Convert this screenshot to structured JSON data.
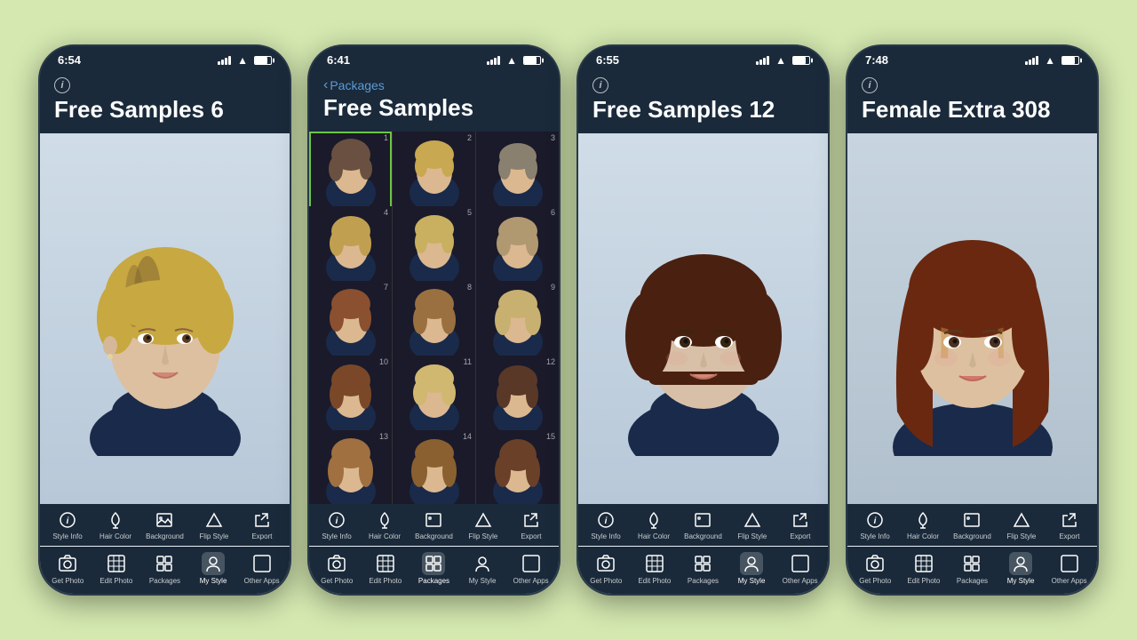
{
  "background_color": "#d4e8b0",
  "phones": [
    {
      "id": "phone1",
      "time": "6:54",
      "title": "Free Samples 6",
      "has_back": false,
      "view": "single",
      "active_nav": "my-style",
      "toolbar": [
        "Style Info",
        "Hair Color",
        "Background",
        "Flip Style",
        "Export"
      ],
      "nav": [
        "Get Photo",
        "Edit Photo",
        "Packages",
        "My Style",
        "Other Apps"
      ]
    },
    {
      "id": "phone2",
      "time": "6:41",
      "title": "Free Samples",
      "has_back": true,
      "back_label": "Packages",
      "view": "grid",
      "active_nav": "packages",
      "grid_items": 15,
      "selected_item": 1,
      "toolbar": [
        "Style Info",
        "Hair Color",
        "Background",
        "Flip Style",
        "Export"
      ],
      "nav": [
        "Get Photo",
        "Edit Photo",
        "Packages",
        "My Style",
        "Other Apps"
      ]
    },
    {
      "id": "phone3",
      "time": "6:55",
      "title": "Free Samples 12",
      "has_back": false,
      "view": "single",
      "active_nav": "my-style",
      "toolbar": [
        "Style Info",
        "Hair Color",
        "Background",
        "Flip Style",
        "Export"
      ],
      "nav": [
        "Get Photo",
        "Edit Photo",
        "Packages",
        "My Style",
        "Other Apps"
      ]
    },
    {
      "id": "phone4",
      "time": "7:48",
      "title": "Female Extra 308",
      "has_back": false,
      "view": "single",
      "active_nav": "my-style",
      "toolbar": [
        "Style Info",
        "Hair Color",
        "Background",
        "Flip Style",
        "Export"
      ],
      "nav": [
        "Get Photo",
        "Edit Photo",
        "Packages",
        "My Style",
        "Other Apps"
      ]
    }
  ],
  "icons": {
    "info": "ℹ",
    "back": "‹",
    "get_photo": "📷",
    "edit_photo": "⊞",
    "packages": "📦",
    "my_style": "👤",
    "other_apps": "⊡",
    "style_info": "ℹ",
    "hair_color": "🪣",
    "background": "🖼",
    "flip_style": "△",
    "export": "↗"
  }
}
